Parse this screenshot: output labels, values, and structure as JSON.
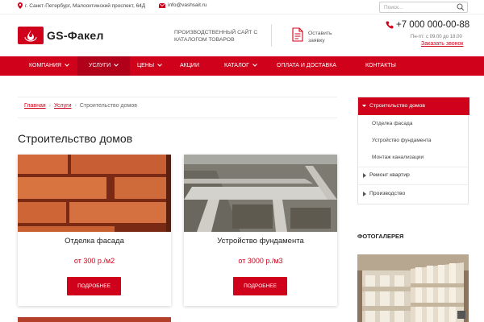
{
  "topbar": {
    "address": "г. Санкт-Петербург, Малоохтинский проспект, 64Д",
    "email": "info@vashsait.ru",
    "search_placeholder": "Поиск..."
  },
  "header": {
    "logo_text": "GS-Факел",
    "tagline": "Производственный сайт с каталогом товаров",
    "order_label": "Оставить заявку",
    "phone": "+7 000 000-00-88",
    "hours": "Пн-пт: с 09.00 до 18.00",
    "callback_label": "Заказать звонок"
  },
  "nav": {
    "items": [
      {
        "label": "Компания",
        "dropdown": true
      },
      {
        "label": "Услуги",
        "dropdown": true,
        "active": true
      },
      {
        "label": "Цены",
        "dropdown": true
      },
      {
        "label": "Акции",
        "dropdown": false
      },
      {
        "label": "Каталог",
        "dropdown": true
      },
      {
        "label": "Оплата и доставка",
        "dropdown": false
      },
      {
        "label": "Контакты",
        "dropdown": false
      }
    ]
  },
  "breadcrumb": {
    "home": "Главная",
    "section": "Услуги",
    "current": "Строительство домов"
  },
  "page": {
    "title": "Строительство домов"
  },
  "cards": [
    {
      "title": "Отделка фасада",
      "price": "от 300 р./м2",
      "button": "Подробнее"
    },
    {
      "title": "Устройство фундамента",
      "price": "от 3000 р./м3",
      "button": "Подробнее"
    }
  ],
  "sidebar": {
    "active": "Строительство домов",
    "subitems": [
      "Отделка фасада",
      "Устройство фундамента",
      "Монтаж канализации"
    ],
    "items": [
      "Ремонт квартир",
      "Производство"
    ]
  },
  "gallery": {
    "title": "Фотогалерея"
  },
  "colors": {
    "accent": "#d0021b",
    "nav_active": "#b0001a"
  },
  "icons": [
    "location-pin-icon",
    "envelope-icon",
    "search-icon",
    "flame-logo-icon",
    "document-icon",
    "phone-icon",
    "chevron-down-icon",
    "triangle-right-icon"
  ]
}
